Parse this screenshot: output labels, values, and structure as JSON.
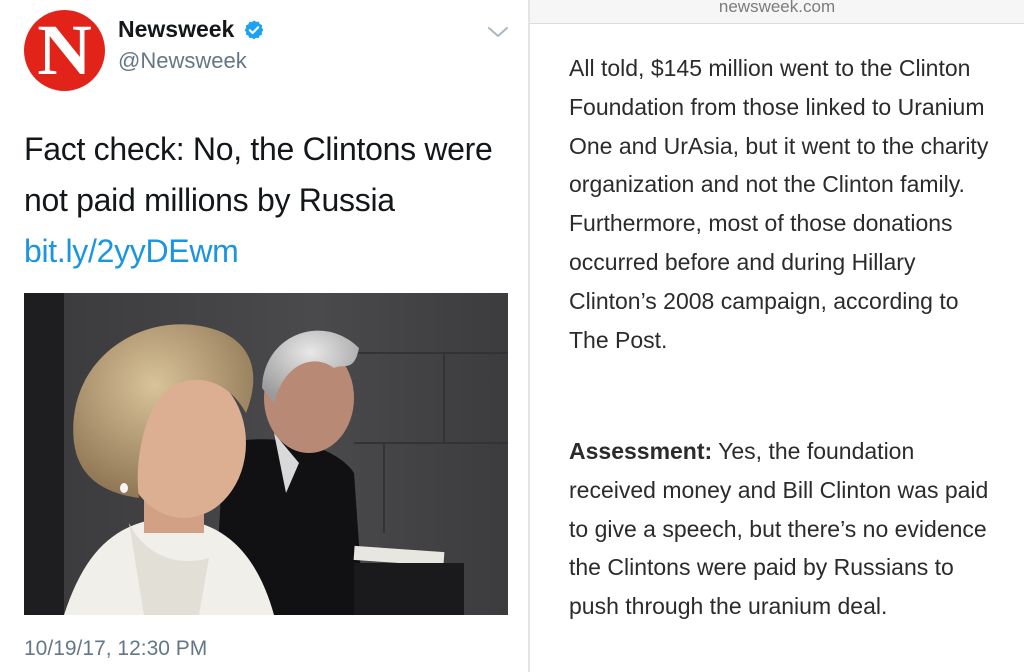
{
  "tweet": {
    "avatar_letter": "N",
    "display_name": "Newsweek",
    "handle": "@Newsweek",
    "verified_icon": "verified-badge-icon",
    "menu_icon": "chevron-down-icon",
    "text": "Fact check: No, the Clintons were not paid millions by Russia",
    "link": "bit.ly/2yyDEwm",
    "timestamp": "10/19/17, 12:30 PM",
    "colors": {
      "brand_red": "#e2231a",
      "link_blue": "#1b95e0",
      "verified_blue": "#1da1f2",
      "secondary_gray": "#657786"
    }
  },
  "article": {
    "url": "newsweek.com",
    "paragraph1": "All told, $145 million went to the Clinton Foundation from those linked to Uranium One and UrAsia, but it went to the charity organization and not the Clinton family. Furthermore, most of those donations occurred before and during Hillary Clinton’s 2008 campaign, according to The Post.",
    "assessment_label": "Assessment:",
    "assessment_text": " Yes, the foundation received money and Bill Clinton was paid to give a speech, but there’s no evidence the Clintons were paid by Russians to push through the uranium deal."
  }
}
